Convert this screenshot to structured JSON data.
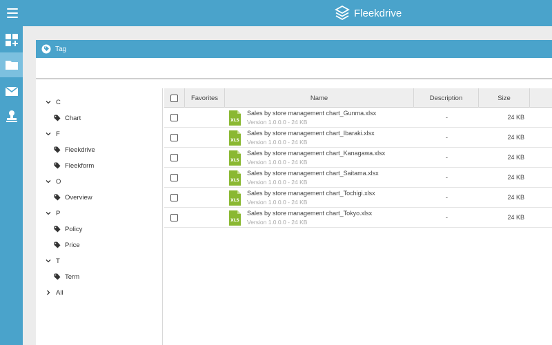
{
  "app": {
    "brand": "Fleekdrive"
  },
  "nav": {
    "icons": [
      "dashboard-add-icon",
      "folder-icon",
      "mail-icon",
      "stamp-icon"
    ]
  },
  "tagbar": {
    "label": "Tag"
  },
  "tree": {
    "items": [
      {
        "kind": "group",
        "label": "C",
        "expanded": true
      },
      {
        "kind": "tag",
        "label": "Chart"
      },
      {
        "kind": "group",
        "label": "F",
        "expanded": true
      },
      {
        "kind": "tag",
        "label": "Fleekdrive"
      },
      {
        "kind": "tag",
        "label": "Fleekform"
      },
      {
        "kind": "group",
        "label": "O",
        "expanded": true
      },
      {
        "kind": "tag",
        "label": "Overview"
      },
      {
        "kind": "group",
        "label": "P",
        "expanded": true
      },
      {
        "kind": "tag",
        "label": "Policy"
      },
      {
        "kind": "tag",
        "label": "Price"
      },
      {
        "kind": "group",
        "label": "T",
        "expanded": true
      },
      {
        "kind": "tag",
        "label": "Term"
      },
      {
        "kind": "group",
        "label": "All",
        "expanded": false
      }
    ]
  },
  "table": {
    "columns": {
      "favorites": "Favorites",
      "name": "Name",
      "description": "Description",
      "size": "Size"
    },
    "file_icon_label": "XLS",
    "rows": [
      {
        "name": "Sales by store management chart_Gunma.xlsx",
        "version": "Version 1.0.0.0 - 24 KB",
        "description": "-",
        "size": "24 KB"
      },
      {
        "name": "Sales by store management chart_Ibaraki.xlsx",
        "version": "Version 1.0.0.0 - 24 KB",
        "description": "-",
        "size": "24 KB"
      },
      {
        "name": "Sales by store management chart_Kanagawa.xlsx",
        "version": "Version 1.0.0.0 - 24 KB",
        "description": "-",
        "size": "24 KB"
      },
      {
        "name": "Sales by store management chart_Saitama.xlsx",
        "version": "Version 1.0.0.0 - 24 KB",
        "description": "-",
        "size": "24 KB"
      },
      {
        "name": "Sales by store management chart_Tochigi.xlsx",
        "version": "Version 1.0.0.0 - 24 KB",
        "description": "-",
        "size": "24 KB"
      },
      {
        "name": "Sales by store management chart_Tokyo.xlsx",
        "version": "Version 1.0.0.0 - 24 KB",
        "description": "-",
        "size": "24 KB"
      }
    ]
  },
  "colors": {
    "primary": "#4aa3cb",
    "nav_active": "#7cc0df",
    "xls_green": "#8ab832",
    "header_bg": "#eeeeee"
  }
}
